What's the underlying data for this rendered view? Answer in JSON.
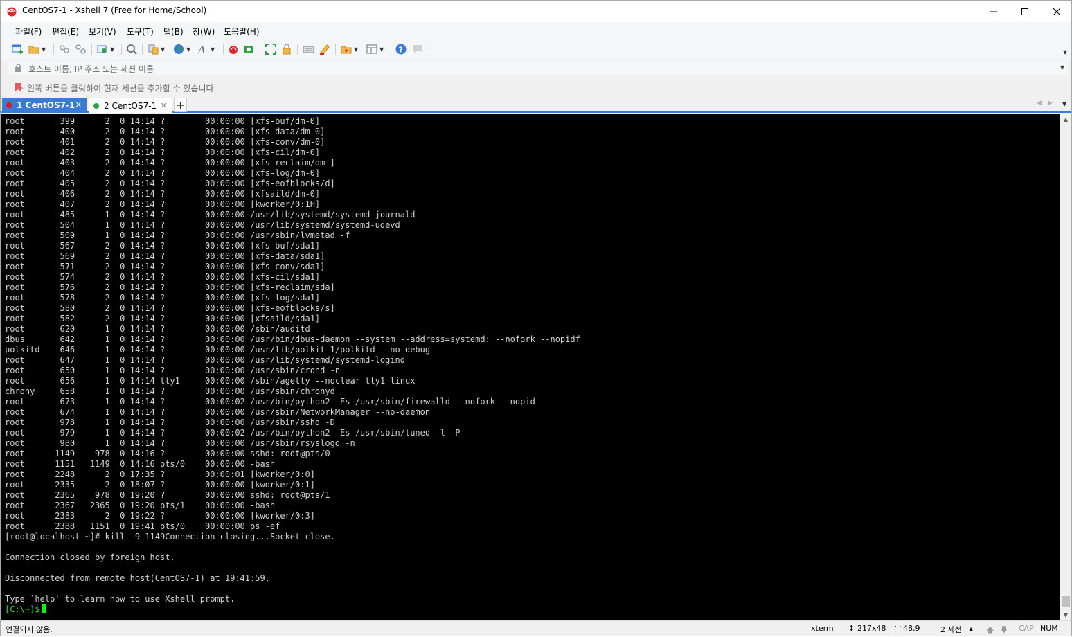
{
  "window": {
    "title": "CentOS7-1 - Xshell 7 (Free for Home/School)"
  },
  "menu": [
    "파일(F)",
    "편집(E)",
    "보기(V)",
    "도구(T)",
    "탭(B)",
    "창(W)",
    "도움말(H)"
  ],
  "address_bar": {
    "placeholder": "호스트 이름, IP 주소 또는 세션 이름"
  },
  "hint_bar": {
    "text": "왼쪽 버튼을 클릭하여 현재 세션을 추가할 수 있습니다."
  },
  "tabs": [
    {
      "label": "1 CentOS7-1",
      "status_color": "#e81123",
      "active": true
    },
    {
      "label": "2 CentOS7-1",
      "status_color": "#1fa83a",
      "active": false
    }
  ],
  "terminal": {
    "lines": [
      "root       399      2  0 14:14 ?        00:00:00 [xfs-buf/dm-0]",
      "root       400      2  0 14:14 ?        00:00:00 [xfs-data/dm-0]",
      "root       401      2  0 14:14 ?        00:00:00 [xfs-conv/dm-0]",
      "root       402      2  0 14:14 ?        00:00:00 [xfs-cil/dm-0]",
      "root       403      2  0 14:14 ?        00:00:00 [xfs-reclaim/dm-]",
      "root       404      2  0 14:14 ?        00:00:00 [xfs-log/dm-0]",
      "root       405      2  0 14:14 ?        00:00:00 [xfs-eofblocks/d]",
      "root       406      2  0 14:14 ?        00:00:00 [xfsaild/dm-0]",
      "root       407      2  0 14:14 ?        00:00:00 [kworker/0:1H]",
      "root       485      1  0 14:14 ?        00:00:00 /usr/lib/systemd/systemd-journald",
      "root       504      1  0 14:14 ?        00:00:00 /usr/lib/systemd/systemd-udevd",
      "root       509      1  0 14:14 ?        00:00:00 /usr/sbin/lvmetad -f",
      "root       567      2  0 14:14 ?        00:00:00 [xfs-buf/sda1]",
      "root       569      2  0 14:14 ?        00:00:00 [xfs-data/sda1]",
      "root       571      2  0 14:14 ?        00:00:00 [xfs-conv/sda1]",
      "root       574      2  0 14:14 ?        00:00:00 [xfs-cil/sda1]",
      "root       576      2  0 14:14 ?        00:00:00 [xfs-reclaim/sda]",
      "root       578      2  0 14:14 ?        00:00:00 [xfs-log/sda1]",
      "root       580      2  0 14:14 ?        00:00:00 [xfs-eofblocks/s]",
      "root       582      2  0 14:14 ?        00:00:00 [xfsaild/sda1]",
      "root       620      1  0 14:14 ?        00:00:00 /sbin/auditd",
      "dbus       642      1  0 14:14 ?        00:00:00 /usr/bin/dbus-daemon --system --address=systemd: --nofork --nopidf",
      "polkitd    646      1  0 14:14 ?        00:00:00 /usr/lib/polkit-1/polkitd --no-debug",
      "root       647      1  0 14:14 ?        00:00:00 /usr/lib/systemd/systemd-logind",
      "root       650      1  0 14:14 ?        00:00:00 /usr/sbin/crond -n",
      "root       656      1  0 14:14 tty1     00:00:00 /sbin/agetty --noclear tty1 linux",
      "chrony     658      1  0 14:14 ?        00:00:00 /usr/sbin/chronyd",
      "root       673      1  0 14:14 ?        00:00:02 /usr/bin/python2 -Es /usr/sbin/firewalld --nofork --nopid",
      "root       674      1  0 14:14 ?        00:00:00 /usr/sbin/NetworkManager --no-daemon",
      "root       978      1  0 14:14 ?        00:00:00 /usr/sbin/sshd -D",
      "root       979      1  0 14:14 ?        00:00:02 /usr/bin/python2 -Es /usr/sbin/tuned -l -P",
      "root       980      1  0 14:14 ?        00:00:00 /usr/sbin/rsyslogd -n",
      "root      1149    978  0 14:16 ?        00:00:00 sshd: root@pts/0",
      "root      1151   1149  0 14:16 pts/0    00:00:00 -bash",
      "root      2248      2  0 17:35 ?        00:00:01 [kworker/0:0]",
      "root      2335      2  0 18:07 ?        00:00:00 [kworker/0:1]",
      "root      2365    978  0 19:20 ?        00:00:00 sshd: root@pts/1",
      "root      2367   2365  0 19:20 pts/1    00:00:00 -bash",
      "root      2383      2  0 19:22 ?        00:00:00 [kworker/0:3]",
      "root      2388   1151  0 19:41 pts/0    00:00:00 ps -ef",
      "[root@localhost ~]# kill -9 1149Connection closing...Socket close.",
      "",
      "Connection closed by foreign host.",
      "",
      "Disconnected from remote host(CentOS7-1) at 19:41:59.",
      "",
      "Type `help' to learn how to use Xshell prompt."
    ],
    "prompt": "[C:\\~]$ "
  },
  "status_bar": {
    "connection": "연결되지 않음.",
    "terminal_type": "xterm",
    "size": "217x48",
    "cursor_pos": "48,9",
    "sessions": "2 세션",
    "cap": "CAP",
    "num": "NUM"
  },
  "icons": {
    "app": "xshell-logo-icon",
    "lock": "lock-icon",
    "bookmark": "bookmark-icon"
  }
}
